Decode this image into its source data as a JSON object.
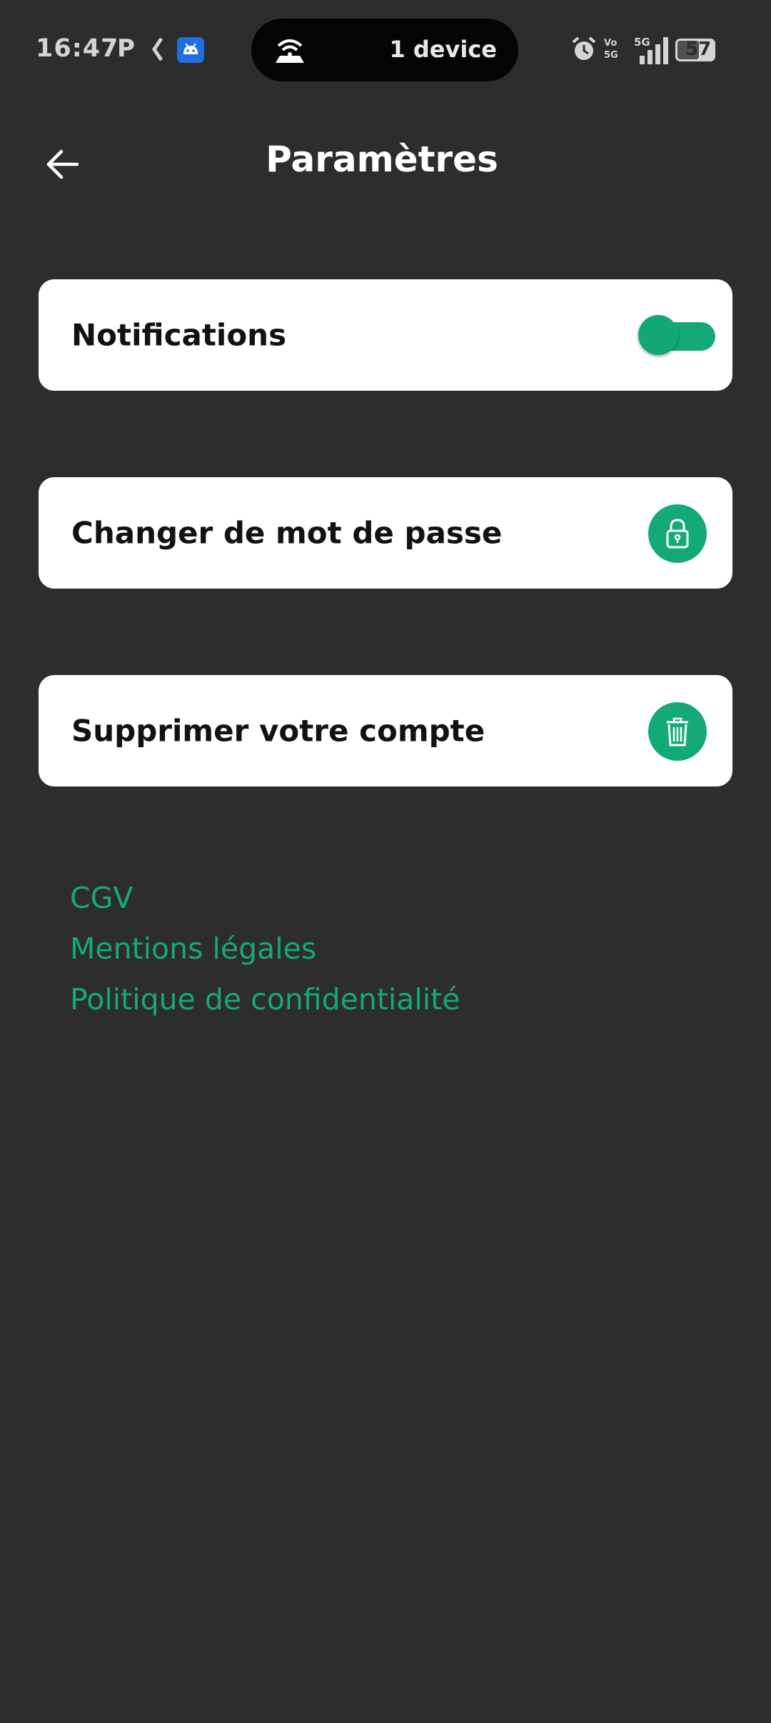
{
  "status_bar": {
    "time": "16:47",
    "app_p": "P",
    "pill_text": "1 device",
    "volte_top": "Vo",
    "volte_bottom": "5G",
    "network": "5G",
    "battery": "57"
  },
  "header": {
    "title": "Paramètres"
  },
  "settings": {
    "notifications": {
      "label": "Notifications",
      "enabled": true
    },
    "change_password": {
      "label": "Changer de mot de passe"
    },
    "delete_account": {
      "label": "Supprimer votre compte"
    }
  },
  "links": {
    "cgv": "CGV",
    "legal": "Mentions légales",
    "privacy": "Politique de confidentialité"
  },
  "colors": {
    "background": "#2d2d2d",
    "card": "#ffffff",
    "accent": "#13aa78",
    "link": "#17a877"
  },
  "icons": {
    "back": "arrow-left-icon",
    "lock": "lock-icon",
    "trash": "trash-icon"
  }
}
